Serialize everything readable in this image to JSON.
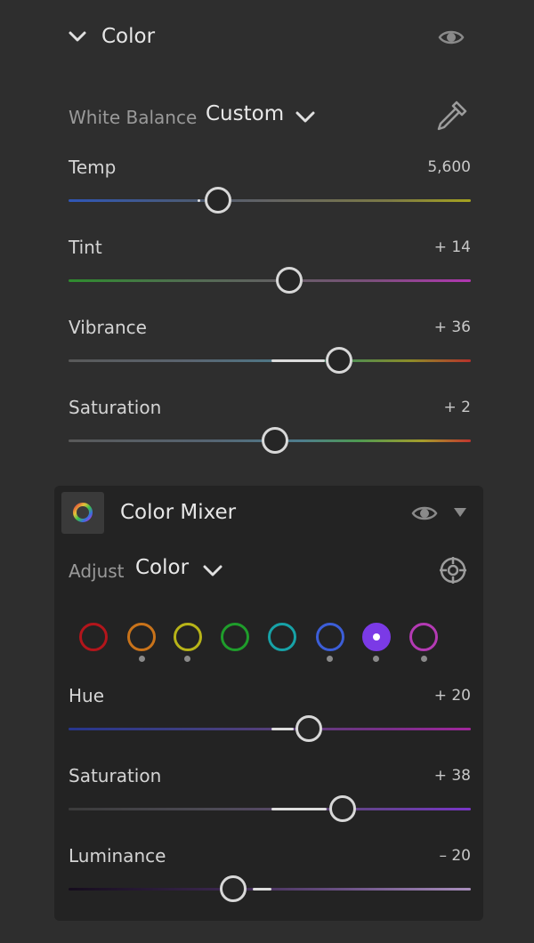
{
  "color_section": {
    "title": "Color",
    "white_balance": {
      "label": "White Balance",
      "value": "Custom"
    },
    "sliders": [
      {
        "label": "Temp",
        "value": "5,600"
      },
      {
        "label": "Tint",
        "value": "+ 14"
      },
      {
        "label": "Vibrance",
        "value": "+ 36"
      },
      {
        "label": "Saturation",
        "value": "+ 2"
      }
    ]
  },
  "color_mixer": {
    "title": "Color Mixer",
    "adjust": {
      "label": "Adjust",
      "value": "Color"
    },
    "swatches": [
      {
        "name": "red",
        "color": "#b3151b",
        "selected": false,
        "modified": false
      },
      {
        "name": "orange",
        "color": "#c9731a",
        "selected": false,
        "modified": true
      },
      {
        "name": "yellow",
        "color": "#b8b418",
        "selected": false,
        "modified": true
      },
      {
        "name": "green",
        "color": "#1f9d2b",
        "selected": false,
        "modified": false
      },
      {
        "name": "aqua",
        "color": "#17a2a7",
        "selected": false,
        "modified": false
      },
      {
        "name": "blue",
        "color": "#3c5ed8",
        "selected": false,
        "modified": true
      },
      {
        "name": "purple",
        "color": "#7b3ae6",
        "selected": true,
        "modified": true
      },
      {
        "name": "magenta",
        "color": "#b43ab4",
        "selected": false,
        "modified": true
      }
    ],
    "sliders": [
      {
        "label": "Hue",
        "value": "+ 20"
      },
      {
        "label": "Saturation",
        "value": "+ 38"
      },
      {
        "label": "Luminance",
        "value": "– 20"
      }
    ]
  }
}
